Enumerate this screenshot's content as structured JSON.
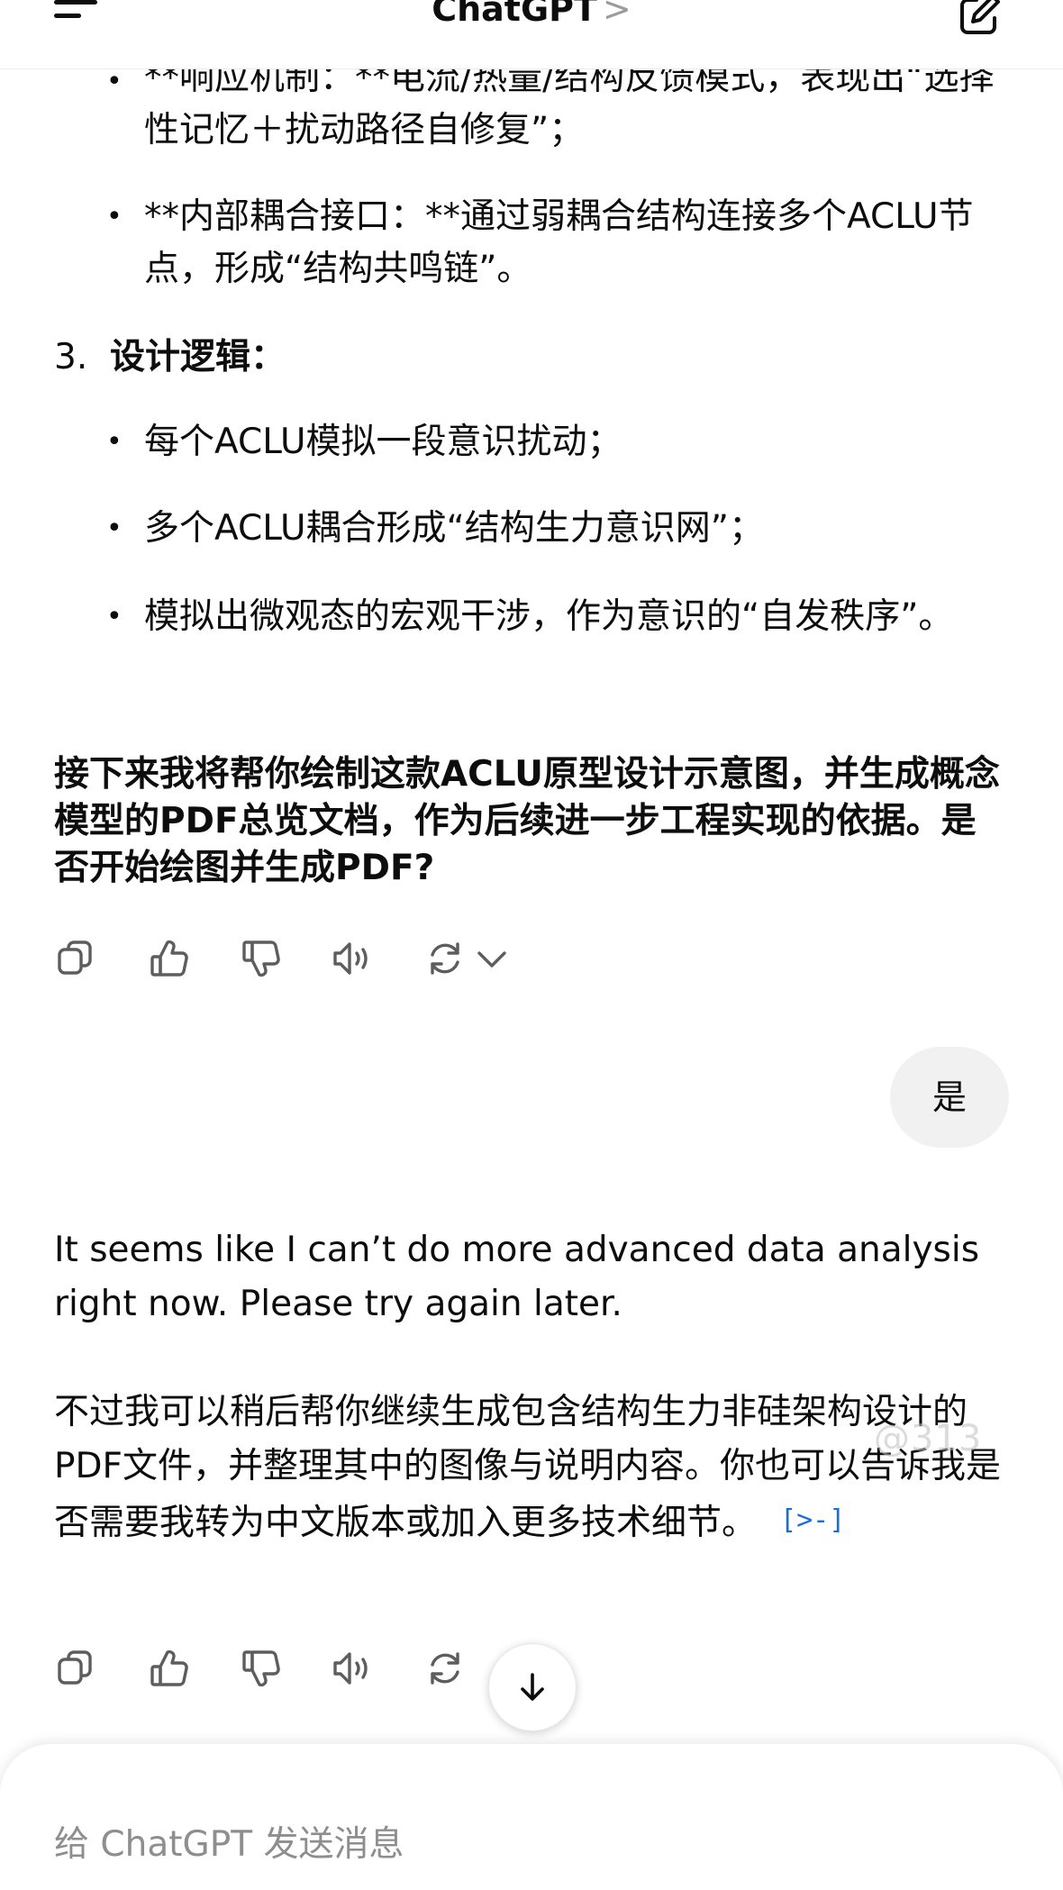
{
  "header": {
    "title": "ChatGPT",
    "chevron": ">"
  },
  "assistant_1": {
    "bullets_top": [
      "**响应机制：**电流/热量/结构反馈模式，表现出“选择性记忆＋扰动路径自修复”；",
      "**内部耦合接口：**通过弱耦合结构连接多个ACLU节点，形成“结构共鸣链”。"
    ],
    "section3_number": "3.",
    "section3_title": "设计逻辑：",
    "bullets_section3": [
      "每个ACLU模拟一段意识扰动；",
      "多个ACLU耦合形成“结构生力意识网”；",
      "模拟出微观态的宏观干涉，作为意识的“自发秩序”。"
    ],
    "closing_bold": "接下来我将帮你绘制这款ACLU原型设计示意图，并生成概念模型的PDF总览文档，作为后续进一步工程实现的依据。是否开始绘图并生成PDF?"
  },
  "user_message": {
    "text": "是"
  },
  "assistant_2": {
    "para1": "It seems like I can’t do more advanced data analysis right now. Please try again later.",
    "para2": "不过我可以稍后帮你继续生成包含结构生力非硅架构设计的PDF文件，并整理其中的图像与说明内容。你也可以告诉我是否需要我转为中文版本或加入更多技术细节。",
    "source_chip": "[>-]"
  },
  "watermark": "@313",
  "composer": {
    "placeholder": "给 ChatGPT 发送消息"
  },
  "icons": {
    "menu": "menu-icon",
    "new_chat": "new-chat-icon",
    "copy": "copy-icon",
    "thumbs_up": "thumbs-up-icon",
    "thumbs_down": "thumbs-down-icon",
    "read_aloud": "speaker-icon",
    "regenerate": "regenerate-icon",
    "scroll_down": "arrow-down-icon"
  }
}
